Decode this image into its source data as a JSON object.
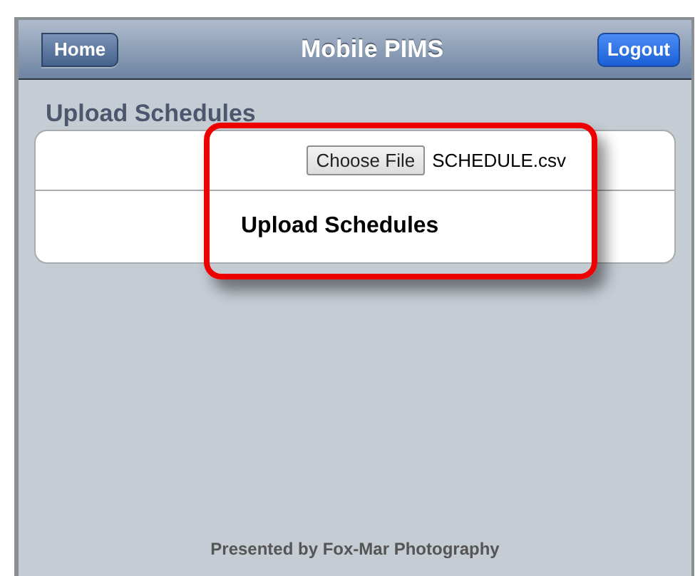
{
  "nav_bar": {
    "back_button": "Home",
    "title": "Mobile PIMS",
    "action_button": "Logout"
  },
  "section_title": "Upload Schedules",
  "form": {
    "file_button": "Choose File",
    "file_name": "SCHEDULE.csv",
    "submit": "Upload Schedules"
  },
  "highlight": {
    "shown": true
  },
  "footer": "Presented by Fox-Mar Photography"
}
